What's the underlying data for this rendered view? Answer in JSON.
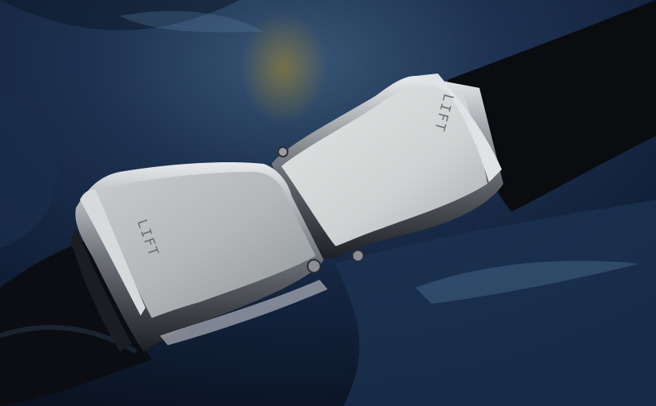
{
  "scene": {
    "subject": "seatbelt-buckles",
    "colors": {
      "leather_dark": "#0b1524",
      "leather_mid": "#1f3552",
      "leather_highlight": "#4e6f93",
      "metal_light": "#d6d8d8",
      "metal_mid": "#aeb2b3",
      "metal_shadow": "#6f7478",
      "strap": "#0a0c10",
      "chrome_dark": "#2a2d33"
    }
  },
  "buckles": [
    {
      "label": "LIFT"
    },
    {
      "label": "LIFT"
    }
  ]
}
